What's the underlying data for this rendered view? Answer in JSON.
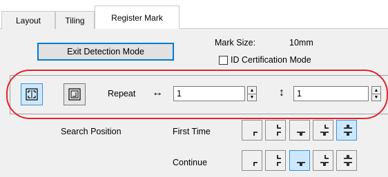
{
  "tabs": [
    {
      "label": "Layout"
    },
    {
      "label": "Tiling"
    },
    {
      "label": "Register Mark"
    }
  ],
  "exit_button": {
    "label": "Exit Detection Mode"
  },
  "mark_size": {
    "label": "Mark Size:",
    "value": "10mm"
  },
  "id_cert": {
    "label": "ID Certification Mode",
    "checked": false
  },
  "repeat": {
    "label": "Repeat",
    "horizontal_icon": "↔",
    "horizontal_value": "1",
    "vertical_icon": "↕",
    "vertical_value": "1"
  },
  "search": {
    "label": "Search Position",
    "first_time_label": "First Time",
    "continue_label": "Continue",
    "first_time_selected_index": 4,
    "continue_selected_index": 2
  },
  "colors": {
    "highlight_ellipse": "#e0242c",
    "selected_fill": "#cce8ff",
    "selected_border": "#3c8fd6"
  }
}
